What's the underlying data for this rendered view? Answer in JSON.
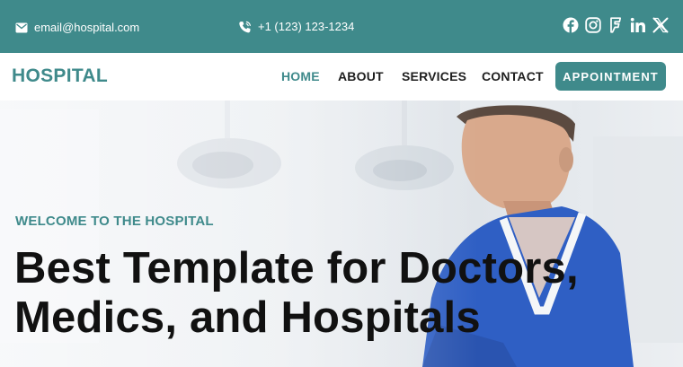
{
  "topbar": {
    "email": "email@hospital.com",
    "phone": "+1 (123) 123-1234",
    "icons": [
      "envelope-icon",
      "phone-icon",
      "facebook-icon",
      "instagram-icon",
      "foursquare-icon",
      "linkedin-icon",
      "x-icon"
    ],
    "background": "#3f8a8b"
  },
  "nav": {
    "logo": "HOSPITAL",
    "links": [
      "HOME",
      "ABOUT",
      "SERVICES",
      "CONTACT"
    ],
    "active": "HOME",
    "cta": "APPOINTMENT",
    "accent": "#3f8a8b"
  },
  "hero": {
    "eyebrow": "WELCOME TO THE HOSPITAL",
    "headline_line1": "Best Template for Doctors,",
    "headline_line2": "Medics, and Hospitals",
    "scrubs_color": "#2f5fc4"
  }
}
